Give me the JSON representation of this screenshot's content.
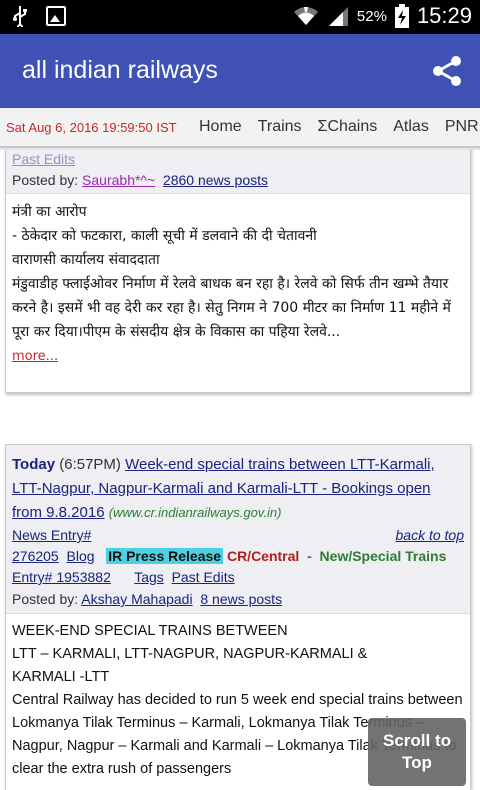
{
  "status_bar": {
    "battery_percent": "52%",
    "time": "15:29",
    "icons": [
      "usb-icon",
      "image-icon",
      "wifi-icon",
      "signal-icon",
      "battery-charging-icon"
    ]
  },
  "app_bar": {
    "title": "all indian railways",
    "share_icon": "share-icon"
  },
  "nav": {
    "date": "Sat Aug 6, 2016 19:59:50 IST",
    "links": [
      "Home",
      "Trains",
      "ΣChains",
      "Atlas",
      "PNR"
    ]
  },
  "post1": {
    "past_edits": "Past Edits",
    "posted_by_label": "Posted by:",
    "author": "Saurabh*^~",
    "news_posts": "2860 news posts",
    "body_lines": [
      "मंत्री का आरोप",
      "- ठेकेदार को फटकारा, काली सूची में डलवाने की दी चेतावनी",
      "वाराणसी कार्यालय संवाददाता",
      "मंडुवाडीह फ्लाईओवर निर्माण में रेलवे बाधक बन रहा है। रेलवे को सिर्फ तीन खम्भे तैयार करने है। इसमें भी वह देरी कर रहा है। सेतु निगम ने 700 मीटर का निर्माण 11 महीने में पूरा कर दिया।पीएम के संसदीय क्षेत्र के विकास का पहिया रेलवे..."
    ],
    "more": "more..."
  },
  "post2": {
    "today": "Today",
    "time": "(6:57PM)",
    "headline": "Week-end special trains between LTT-Karmali, LTT-Nagpur, Nagpur-Karmali and Karmali-LTT - Bookings open from 9.8.2016",
    "source": "(www.cr.indianrailways.gov.in)",
    "news_entry": "News Entry#",
    "back_to_top": "back to top",
    "entry_id": "276205",
    "blog": "Blog",
    "ir_press": "IR Press Release",
    "zone": "CR/Central",
    "dash": "-",
    "category": "New/Special Trains",
    "entry_no": "Entry# 1953882",
    "tags": "Tags",
    "past_edits": "Past Edits",
    "posted_by_label": "Posted by:",
    "author": "Akshay Mahapadi",
    "news_posts": "8 news posts",
    "body_lines": [
      "WEEK-END SPECIAL TRAINS BETWEEN",
      "LTT – KARMALI, LTT-NAGPUR, NAGPUR-KARMALI &",
      "KARMALI -LTT",
      "Central Railway has decided to run 5 week end special trains between Lokmanya Tilak Terminus – Karmali, Lokmanya Tilak Terminus – Nagpur, Nagpur – Karmali and Karmali – Lokmanya Tilak Terminus to clear the extra rush of passengers"
    ]
  },
  "scroll_to_top": {
    "line1": "Scroll to",
    "line2": "Top"
  }
}
